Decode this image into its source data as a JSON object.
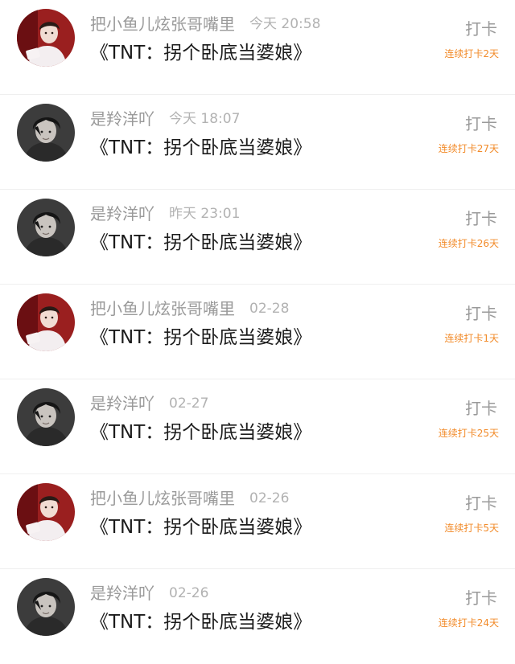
{
  "checkin_list": {
    "items": [
      {
        "username": "把小鱼儿炫张哥嘴里",
        "time": "今天 20:58",
        "title": "《TNT：拐个卧底当婆娘》",
        "action_label": "打卡",
        "streak": "连续打卡2天",
        "avatar": "red-white-avatar"
      },
      {
        "username": "是羚洋吖",
        "time": "今天 18:07",
        "title": "《TNT：拐个卧底当婆娘》",
        "action_label": "打卡",
        "streak": "连续打卡27天",
        "avatar": "dark-avatar"
      },
      {
        "username": "是羚洋吖",
        "time": "昨天 23:01",
        "title": "《TNT：拐个卧底当婆娘》",
        "action_label": "打卡",
        "streak": "连续打卡26天",
        "avatar": "dark-avatar"
      },
      {
        "username": "把小鱼儿炫张哥嘴里",
        "time": "02-28",
        "title": "《TNT：拐个卧底当婆娘》",
        "action_label": "打卡",
        "streak": "连续打卡1天",
        "avatar": "red-white-avatar"
      },
      {
        "username": "是羚洋吖",
        "time": "02-27",
        "title": "《TNT：拐个卧底当婆娘》",
        "action_label": "打卡",
        "streak": "连续打卡25天",
        "avatar": "dark-avatar"
      },
      {
        "username": "把小鱼儿炫张哥嘴里",
        "time": "02-26",
        "title": "《TNT：拐个卧底当婆娘》",
        "action_label": "打卡",
        "streak": "连续打卡5天",
        "avatar": "red-white-avatar"
      },
      {
        "username": "是羚洋吖",
        "time": "02-26",
        "title": "《TNT：拐个卧底当婆娘》",
        "action_label": "打卡",
        "streak": "连续打卡24天",
        "avatar": "dark-avatar"
      }
    ]
  },
  "colors": {
    "streak": "#f28b2a",
    "muted_text": "#9a9a9a",
    "title_text": "#1b1b1b",
    "divider": "#efefef"
  }
}
